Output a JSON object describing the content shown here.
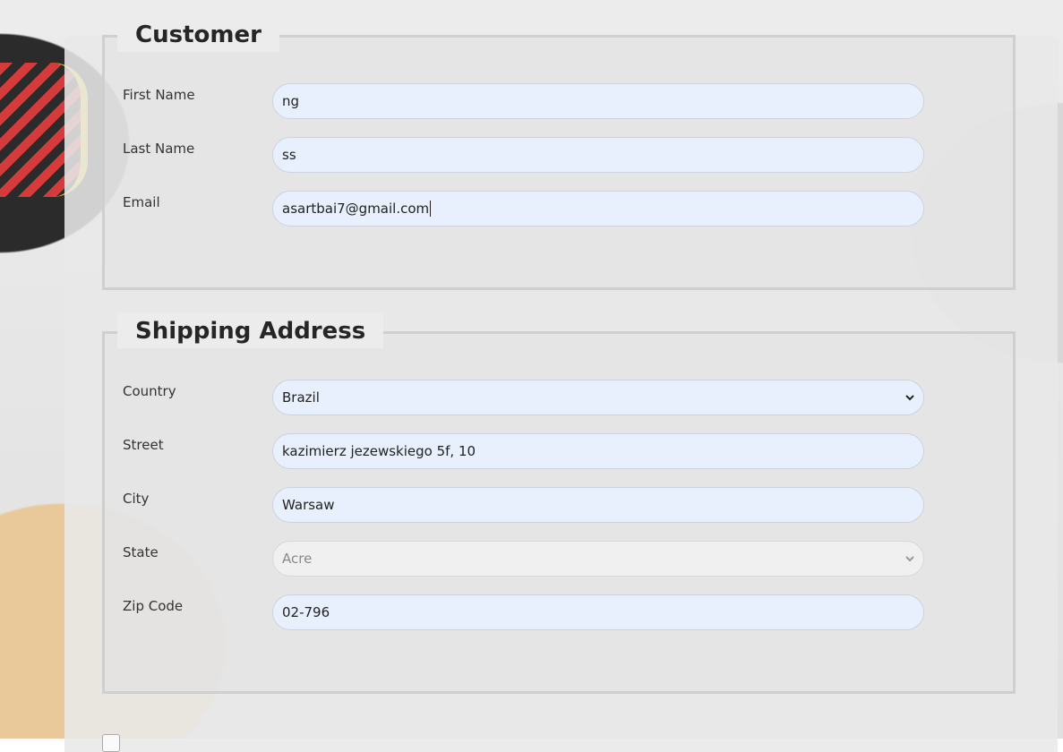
{
  "customer": {
    "legend": "Customer",
    "first_name": {
      "label": "First Name",
      "value": "ng"
    },
    "last_name": {
      "label": "Last Name",
      "value": "ss"
    },
    "email": {
      "label": "Email",
      "value": "asartbai7@gmail.com"
    }
  },
  "shipping": {
    "legend": "Shipping Address",
    "country": {
      "label": "Country",
      "value": "Brazil"
    },
    "street": {
      "label": "Street",
      "value": "kazimierz jezewskiego 5f, 10"
    },
    "city": {
      "label": "City",
      "value": "Warsaw"
    },
    "state": {
      "label": "State",
      "value": "Acre"
    },
    "zip": {
      "label": "Zip Code",
      "value": "02-796"
    }
  },
  "colors": {
    "input_bg": "#e8f0fe",
    "disabled_bg": "#f0f0f0",
    "border": "#cfcfcf"
  },
  "icons": {
    "dropdown": "chevron-down-icon"
  }
}
